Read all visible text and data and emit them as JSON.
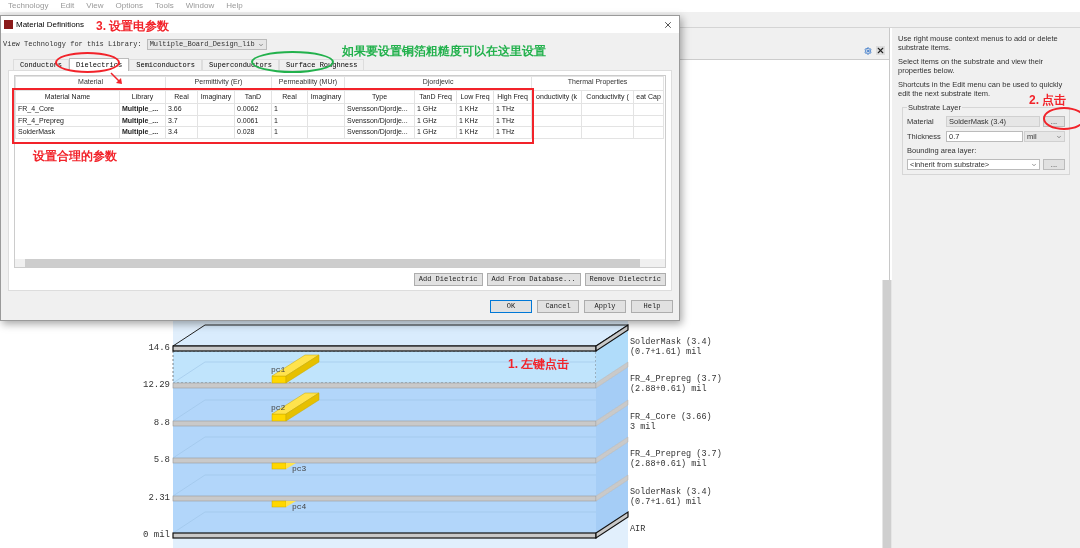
{
  "menu": [
    "Technology",
    "Edit",
    "View",
    "Options",
    "Tools",
    "Window",
    "Help"
  ],
  "dialog": {
    "title": "Material Definitions",
    "library_label": "View Technology for this Library:",
    "library": "Multiple_Board_Design_lib",
    "tabs": [
      {
        "label": "Conductors",
        "selected": false
      },
      {
        "label": "Dielectrics",
        "selected": true
      },
      {
        "label": "Semiconductors",
        "selected": false
      },
      {
        "label": "Superconductors",
        "selected": false
      },
      {
        "label": "Surface Roughness",
        "selected": false
      }
    ],
    "table": {
      "groups": [
        {
          "label": "Material",
          "columns": [
            "Material Name",
            "Library"
          ]
        },
        {
          "label": "Permittivity (Er)",
          "columns": [
            "Real",
            "Imaginary",
            "TanD"
          ]
        },
        {
          "label": "Permeability (MUr)",
          "columns": [
            "Real",
            "Imaginary"
          ]
        },
        {
          "label": "Djordjevic",
          "columns": [
            "Type",
            "TanD Freq",
            "Low Freq",
            "High Freq"
          ]
        },
        {
          "label": "Thermal Properties",
          "columns": [
            "onductivity (k",
            "Conductivity (",
            "eat Cap"
          ]
        }
      ],
      "rows": [
        [
          "FR_4_Core",
          "Multiple_...",
          "3.66",
          null,
          "0.0062",
          "1",
          null,
          "Svensson/Djordje...",
          "1 GHz",
          "1 KHz",
          "1 THz",
          null,
          null,
          null
        ],
        [
          "FR_4_Prepreg",
          "Multiple_...",
          "3.7",
          null,
          "0.0061",
          "1",
          null,
          "Svensson/Djordje...",
          "1 GHz",
          "1 KHz",
          "1 THz",
          null,
          null,
          null
        ],
        [
          "SolderMask",
          "Multiple_...",
          "3.4",
          null,
          "0.028",
          "1",
          null,
          "Svensson/Djordje...",
          "1 GHz",
          "1 KHz",
          "1 THz",
          null,
          null,
          null
        ]
      ]
    },
    "table_buttons": [
      "Add Dielectric",
      "Add From Database...",
      "Remove Dielectric"
    ],
    "footer_buttons": [
      {
        "label": "OK",
        "default": true
      },
      {
        "label": "Cancel",
        "default": false
      },
      {
        "label": "Apply",
        "default": false
      },
      {
        "label": "Help",
        "default": false
      }
    ]
  },
  "right_panel": {
    "hints": [
      "Use right mouse context menus to add or delete substrate items.",
      "Select items on the substrate and view their properties below.",
      "Shortcuts in the Edit menu can be used to quickly edit the next substrate item."
    ],
    "group": {
      "title": "Substrate Layer",
      "material_label": "Material",
      "material": "SolderMask (3.4)",
      "browse": "...",
      "thickness_label": "Thickness",
      "thickness": "0.7",
      "unit": "mil",
      "bounding_label": "Bounding area layer:",
      "bounding": "<inherit from substrate>",
      "bounding_browse": "..."
    }
  },
  "stack": {
    "ticks": [
      "14.6",
      "12.29",
      "8.8",
      "5.8",
      "2.31",
      "0 mil"
    ],
    "layers": [
      {
        "material": "SolderMask (3.4)",
        "thickness": "(0.7+1.61) mil",
        "selected": true
      },
      {
        "material": "FR_4_Prepreg (3.7)",
        "thickness": "(2.88+0.61) mil",
        "selected": false
      },
      {
        "material": "FR_4_Core (3.66)",
        "thickness": "3 mil",
        "selected": false
      },
      {
        "material": "FR_4_Prepreg (3.7)",
        "thickness": "(2.88+0.61) mil",
        "selected": false
      },
      {
        "material": "SolderMask (3.4)",
        "thickness": "(0.7+1.61) mil",
        "selected": false
      },
      {
        "material": "AIR"
      }
    ],
    "traces": [
      {
        "label": "pc1",
        "kind": "above"
      },
      {
        "label": "pc2",
        "kind": "above"
      },
      {
        "label": "pc3",
        "kind": "below"
      },
      {
        "label": "pc4",
        "kind": "below"
      }
    ]
  },
  "annotations": {
    "step1": "1. 左键点击",
    "step2": "2. 点击",
    "step3": "3. 设置电参数",
    "table_note": "设置合理的参数",
    "roughness_note": "如果要设置铜箔粗糙度可以在这里设置"
  }
}
